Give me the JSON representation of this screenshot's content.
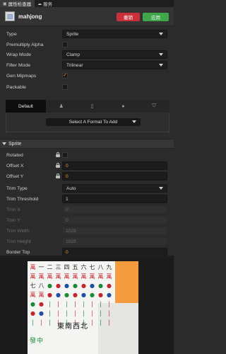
{
  "tabs": [
    {
      "label": "属性检查器",
      "icon": "info-icon",
      "active": true
    },
    {
      "label": "服务",
      "icon": "cloud-icon",
      "active": false
    }
  ],
  "asset": {
    "name": "mahjong",
    "icon": "image-file-icon"
  },
  "buttons": {
    "revert": "撤销",
    "apply": "应用"
  },
  "colors": {
    "revert": "#c9303a",
    "apply": "#3fa64a",
    "accent": "#f39a22"
  },
  "texture": {
    "type": {
      "label": "Type",
      "value": "Sprite"
    },
    "premultiply_alpha": {
      "label": "Premultiply Alpha",
      "checked": false
    },
    "wrap_mode": {
      "label": "Wrap Mode",
      "value": "Clamp"
    },
    "filter_mode": {
      "label": "Filter Mode",
      "value": "Trilinear"
    },
    "gen_mipmaps": {
      "label": "Gen Mipmaps",
      "checked": true,
      "mark": "✓"
    },
    "packable": {
      "label": "Packable",
      "checked": false
    }
  },
  "platform_tabs": [
    {
      "label": "Default",
      "icon": "",
      "active": true
    },
    {
      "label": "",
      "icon": "android-icon",
      "active": false
    },
    {
      "label": "",
      "icon": "mobile-icon",
      "active": false
    },
    {
      "label": "",
      "icon": "wechat-icon",
      "active": false
    },
    {
      "label": "",
      "icon": "html5-icon",
      "active": false
    }
  ],
  "platform_glyphs": {
    "android": "♟",
    "mobile": "▯",
    "wechat": "●",
    "html5": "⛉"
  },
  "format_select": "Select A Format To Add",
  "sprite": {
    "section_title": "Sprite",
    "rotated": {
      "label": "Rotated",
      "checked": false
    },
    "offset_x": {
      "label": "Offset X",
      "value": "0"
    },
    "offset_y": {
      "label": "Offset Y",
      "value": "0"
    },
    "trim_type": {
      "label": "Trim Type",
      "value": "Auto"
    },
    "trim_threshold": {
      "label": "Trim Threshold",
      "value": "1"
    },
    "trim_x": {
      "label": "Trim X",
      "value": "0"
    },
    "trim_y": {
      "label": "Trim Y",
      "value": "0"
    },
    "trim_width": {
      "label": "Trim Width",
      "value": "1023"
    },
    "trim_height": {
      "label": "Trim Height",
      "value": "1023"
    },
    "border_top": {
      "label": "Border Top",
      "value": "0"
    }
  },
  "preview": {
    "tiles": [
      "萬",
      "一",
      "二",
      "三",
      "四",
      "五",
      "六",
      "七",
      "八",
      "九",
      "萬",
      "萬",
      "萬",
      "萬",
      "萬",
      "萬",
      "萬",
      "萬",
      "萬",
      "萬",
      "七",
      "八",
      "●",
      "●",
      "●",
      "●",
      "●",
      "●",
      "●",
      "●",
      "萬",
      "萬",
      "●",
      "●",
      "●",
      "●",
      "●",
      "●",
      "●",
      "●",
      "●",
      "●",
      "|",
      "|",
      "|",
      "|",
      "|",
      "|",
      "|",
      "|",
      "●",
      "●",
      "|",
      "|",
      "|",
      "|",
      "|",
      "|",
      "|",
      "|",
      "|",
      "|",
      "|",
      "|",
      "|",
      "|",
      "|",
      "|",
      "|",
      "|"
    ],
    "winds": "東南西北",
    "bottom": "發中"
  }
}
